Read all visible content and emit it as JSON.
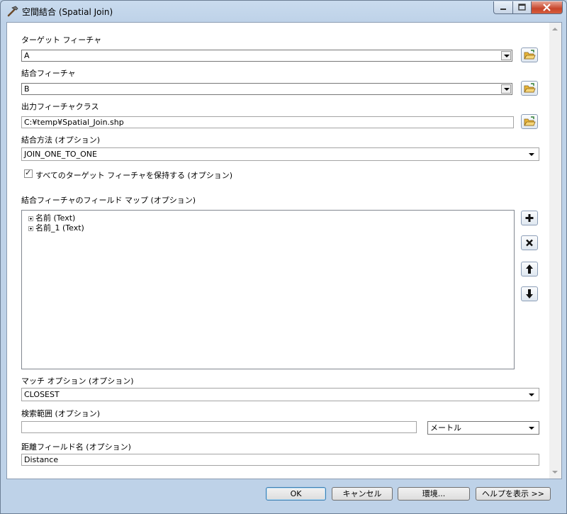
{
  "window": {
    "title": "空間結合 (Spatial Join)"
  },
  "target_features": {
    "label": "ターゲット フィーチャ",
    "value": "A"
  },
  "join_features": {
    "label": "結合フィーチャ",
    "value": "B"
  },
  "output": {
    "label": "出力フィーチャクラス",
    "value": "C:¥temp¥Spatial_Join.shp"
  },
  "join_operation": {
    "label": "結合方法 (オプション)",
    "value": "JOIN_ONE_TO_ONE"
  },
  "keep_all": {
    "label": "すべてのターゲット フィーチャを保持する (オプション)",
    "checked": true
  },
  "field_map": {
    "label": "結合フィーチャのフィールド マップ (オプション)",
    "items": [
      {
        "label": "名前 (Text)"
      },
      {
        "label": "名前_1 (Text)"
      }
    ]
  },
  "match_option": {
    "label": "マッチ オプション (オプション)",
    "value": "CLOSEST"
  },
  "search_radius": {
    "label": "検索範囲 (オプション)",
    "value": "",
    "unit": "メートル"
  },
  "distance_field": {
    "label": "距離フィールド名 (オプション)",
    "value": "Distance"
  },
  "buttons": {
    "ok": "OK",
    "cancel": "キャンセル",
    "env": "環境...",
    "help": "ヘルプを表示 >>"
  }
}
